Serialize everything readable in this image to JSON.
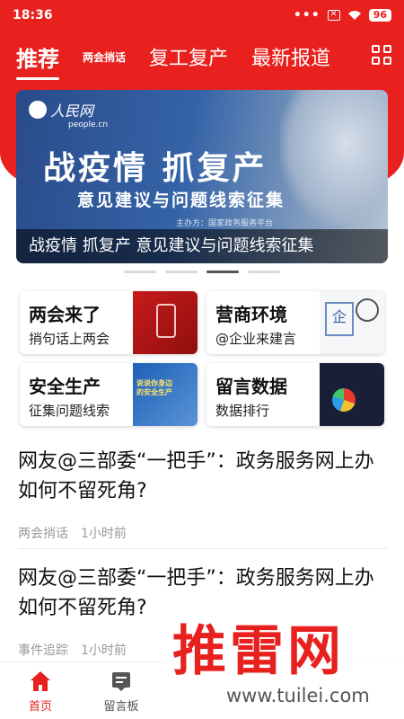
{
  "status_bar": {
    "time": "18:36",
    "dots": "•••",
    "sim": "✕",
    "battery": "96"
  },
  "tabs": [
    {
      "label": "推荐"
    },
    {
      "label": "两会捎话"
    },
    {
      "label": "复工复产"
    },
    {
      "label": "最新报道"
    }
  ],
  "banner": {
    "logo": "人民网",
    "logo_url": "people.cn",
    "headline": "战疫情 抓复产",
    "subline": "意见建议与问题线索征集",
    "organizer": "主办方：国家政务服务平台",
    "caption": "战疫情 抓复产 意见建议与问题线索征集"
  },
  "carousel": {
    "count": 4,
    "active_index": 2
  },
  "cards": [
    {
      "title": "两会来了",
      "subtitle": "捎句话上两会"
    },
    {
      "title": "营商环境",
      "subtitle": "@企业来建言"
    },
    {
      "title": "安全生产",
      "subtitle": "征集问题线索"
    },
    {
      "title": "留言数据",
      "subtitle": "数据排行"
    }
  ],
  "news": [
    {
      "title": "网友@三部委“一把手”：政务服务网上办如何不留死角?",
      "tag": "两会捎话",
      "time": "1小时前"
    },
    {
      "title": "网友@三部委“一把手”：政务服务网上办如何不留死角?",
      "tag": "事件追踪",
      "time": "1小时前"
    }
  ],
  "bottom_nav": [
    {
      "label": "首页",
      "icon": "home-icon"
    },
    {
      "label": "留言板",
      "icon": "message-board-icon"
    }
  ],
  "watermark": {
    "text": "推雷网",
    "url": "www.tuilei.com"
  },
  "colors": {
    "brand_red": "#e8201e"
  }
}
